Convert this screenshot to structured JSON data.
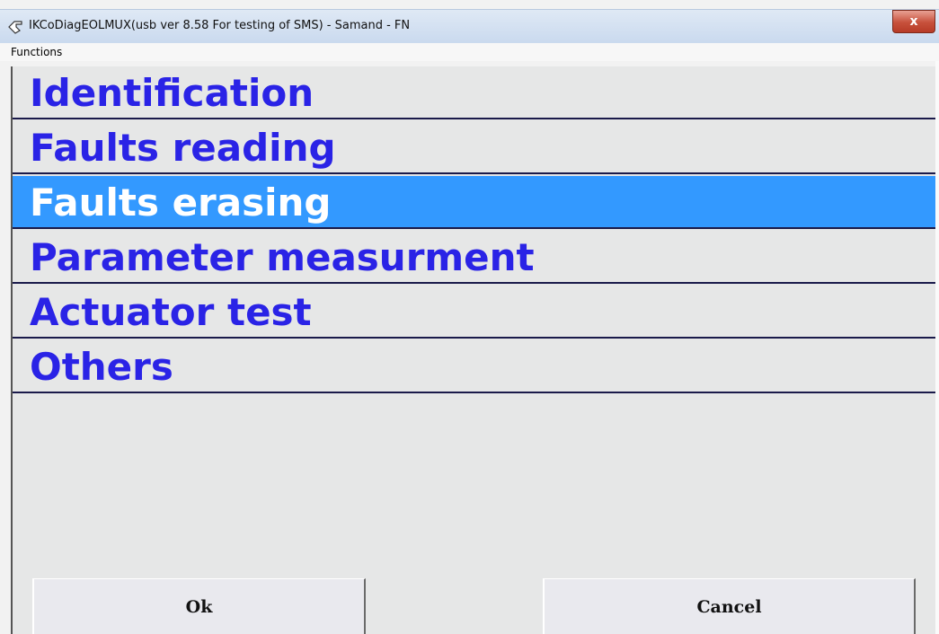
{
  "window": {
    "title": "IKCoDiagEOLMUX(usb ver 8.58 For testing of SMS)  - Samand - FN",
    "close_label": "x"
  },
  "menu": {
    "functions_label": "Functions"
  },
  "function_list": {
    "items": [
      {
        "label": "Identification"
      },
      {
        "label": "Faults reading"
      },
      {
        "label": "Faults erasing"
      },
      {
        "label": "Parameter measurment"
      },
      {
        "label": "Actuator test"
      },
      {
        "label": "Others"
      }
    ],
    "selected_label": "Faults erasing"
  },
  "buttons": {
    "ok_label": "Ok",
    "cancel_label": "Cancel"
  },
  "colors": {
    "item_text": "#2a23e6",
    "selected_bg": "#3399ff",
    "selected_text": "#ffffff",
    "panel_bg": "#e6e7e7"
  },
  "icons": {
    "title_icon": "app-pointer-icon",
    "close_icon": "close-icon"
  }
}
